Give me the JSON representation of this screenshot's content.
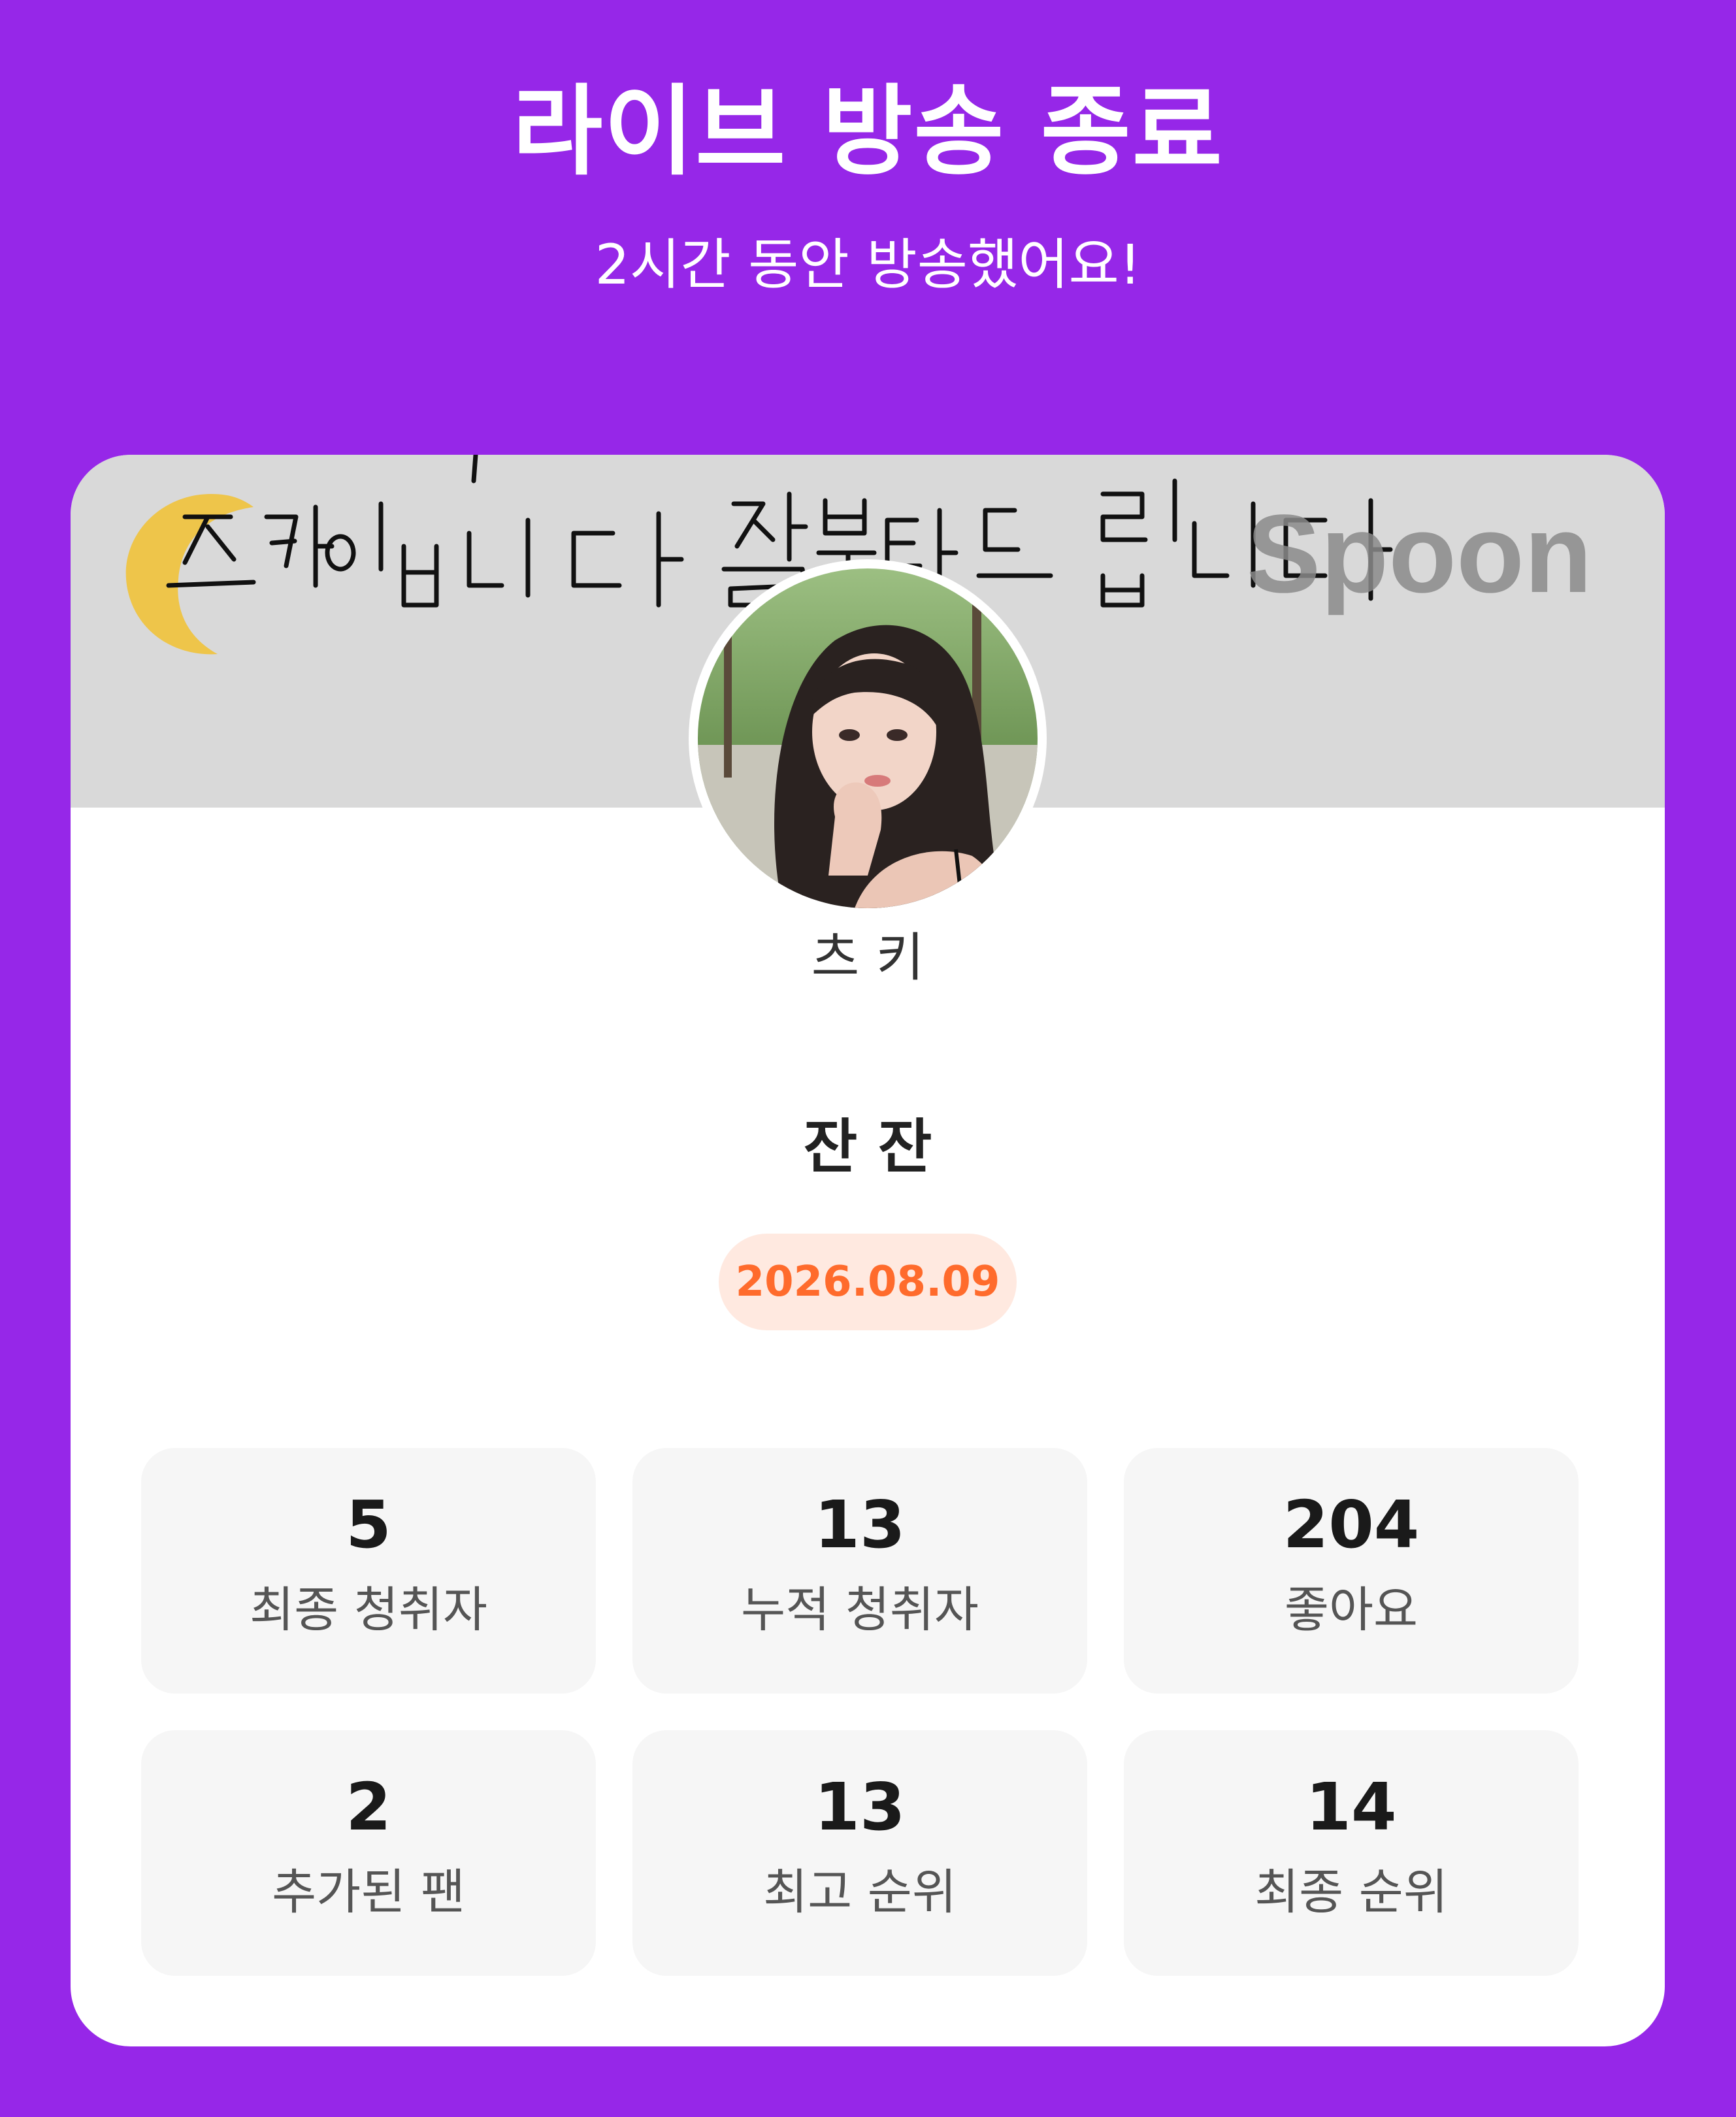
{
  "header": {
    "title": "라이브 방송 종료",
    "subtitle": "2시간 동안 방송했어요!"
  },
  "banner": {
    "handwriting": "츠키입니다 잘부탁드립니다",
    "watermark": "Spoon",
    "background_color": "#D9D9D9"
  },
  "profile": {
    "dj_name": "츠 키",
    "avatar_icon": "profile-photo"
  },
  "live": {
    "title": "잔 잔",
    "date": "2026.08.09"
  },
  "stats": [
    {
      "value": "5",
      "label": "최종 청취자"
    },
    {
      "value": "13",
      "label": "누적 청취자"
    },
    {
      "value": "204",
      "label": "좋아요"
    },
    {
      "value": "2",
      "label": "추가된 팬"
    },
    {
      "value": "13",
      "label": "최고 순위"
    },
    {
      "value": "14",
      "label": "최종 순위"
    }
  ],
  "colors": {
    "background": "#9627E8",
    "card": "#FFFFFF",
    "date_badge_bg": "#FFE9E0",
    "date_badge_text": "#FF6B2C",
    "stat_box": "#F6F6F6"
  }
}
